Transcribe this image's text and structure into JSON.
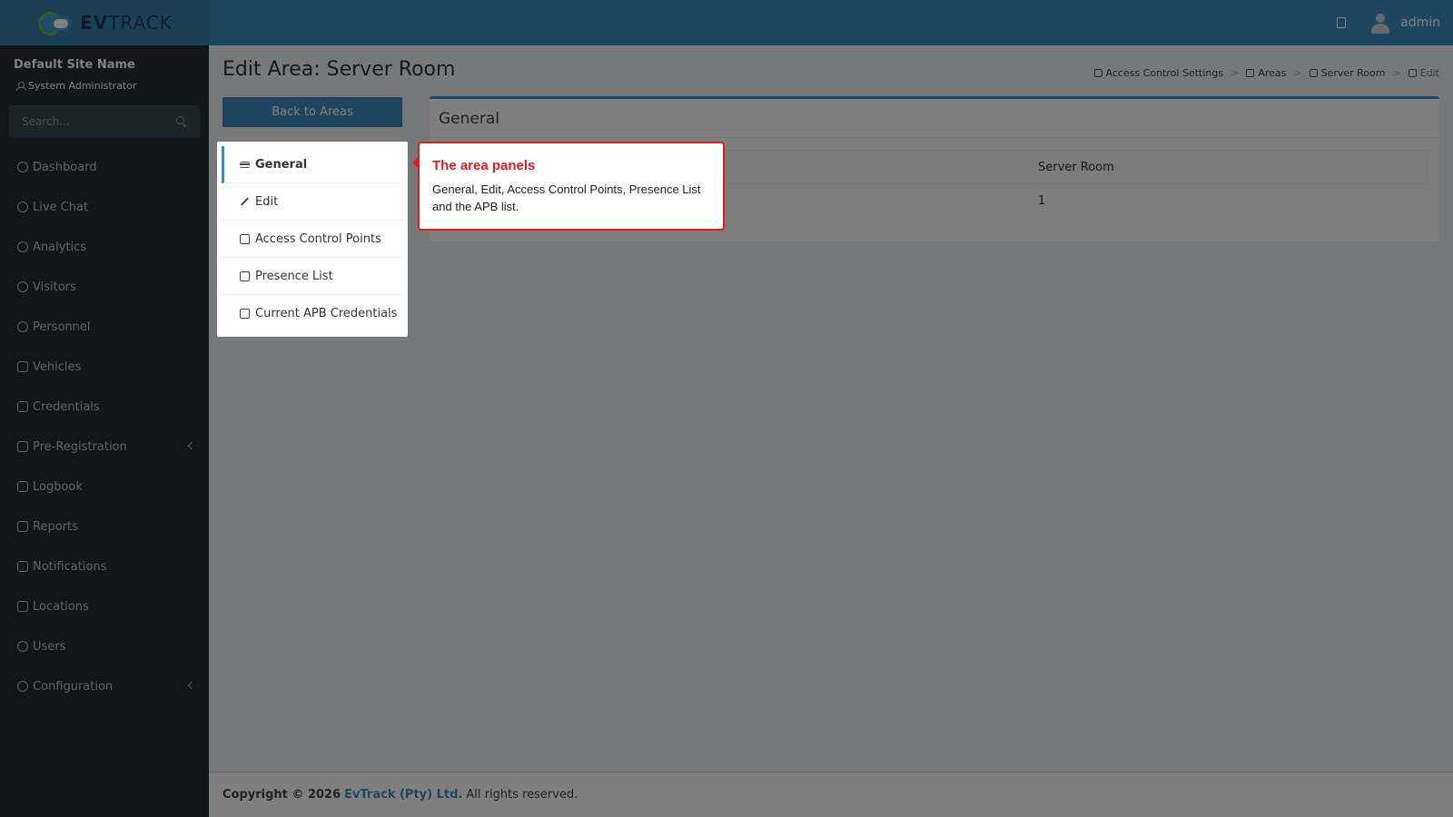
{
  "header": {
    "logo_text_bold": "EV",
    "logo_text_light": "TRACK",
    "username": "admin"
  },
  "sidebar": {
    "site_name": "Default Site Name",
    "role": "System Administrator",
    "search_placeholder": "Search...",
    "items": [
      {
        "label": "Dashboard",
        "icon": "dashboard-icon"
      },
      {
        "label": "Live Chat",
        "icon": "headset-icon"
      },
      {
        "label": "Analytics",
        "icon": "analytics-icon"
      },
      {
        "label": "Visitors",
        "icon": "eye-icon"
      },
      {
        "label": "Personnel",
        "icon": "personnel-icon"
      },
      {
        "label": "Vehicles",
        "icon": "vehicle-icon"
      },
      {
        "label": "Credentials",
        "icon": "credentials-icon"
      },
      {
        "label": "Pre-Registration",
        "icon": "exchange-icon",
        "expandable": true
      },
      {
        "label": "Logbook",
        "icon": "book-icon"
      },
      {
        "label": "Reports",
        "icon": "reports-icon"
      },
      {
        "label": "Notifications",
        "icon": "chat-icon"
      },
      {
        "label": "Locations",
        "icon": "map-icon"
      },
      {
        "label": "Users",
        "icon": "users-icon"
      },
      {
        "label": "Configuration",
        "icon": "gear-icon",
        "expandable": true
      }
    ]
  },
  "page": {
    "title": "Edit Area: Server Room",
    "back_button": "Back to Areas",
    "breadcrumb": [
      "Access Control Settings",
      "Areas",
      "Server Room",
      "Edit"
    ]
  },
  "panels": [
    {
      "label": "General",
      "icon": "list-icon",
      "active": true
    },
    {
      "label": "Edit",
      "icon": "pencil-icon"
    },
    {
      "label": "Access Control Points",
      "icon": "door-icon"
    },
    {
      "label": "Presence List",
      "icon": "walking-icon"
    },
    {
      "label": "Current APB Credentials",
      "icon": "lock-icon"
    }
  ],
  "general": {
    "title": "General",
    "rows": [
      {
        "label": "",
        "value": "Server Room"
      },
      {
        "label": "",
        "value": "1"
      }
    ]
  },
  "tour": {
    "title": "The area panels",
    "body": "General, Edit, Access Control Points, Presence List and the APB list."
  },
  "footer": {
    "copyright": "Copyright © 2026",
    "company": "EvTrack (Pty) Ltd.",
    "rights": "All rights reserved."
  },
  "colors": {
    "header": "#3c8dbc",
    "sidebar": "#222d32",
    "tooltip_accent": "#e01e1e"
  }
}
